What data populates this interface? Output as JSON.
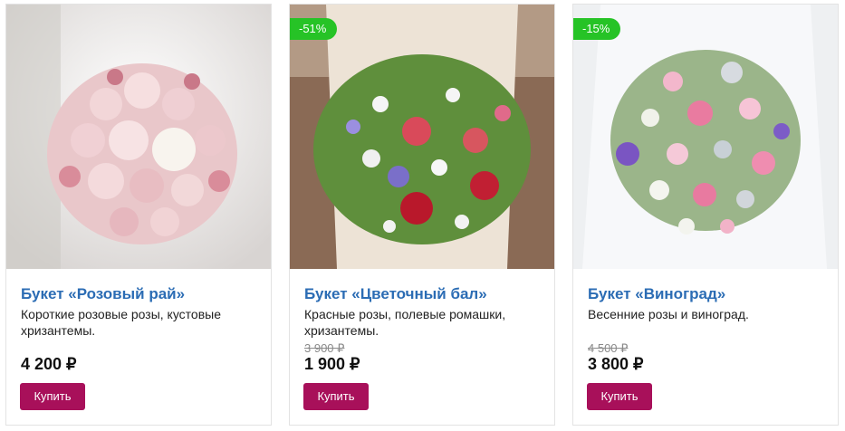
{
  "products": [
    {
      "title": "Букет «Розовый рай»",
      "description": "Короткие розовые розы, кустовые хризантемы.",
      "price": "4 200 ₽",
      "buy_label": "Купить",
      "image_icon": "pink-rose-bouquet-photo"
    },
    {
      "badge": "-51%",
      "title": "Букет «Цветочный бал»",
      "description": "Красные розы, полевые ромашки, хризантемы.",
      "old_price": "3 900 ₽",
      "price": "1 900 ₽",
      "buy_label": "Купить",
      "image_icon": "wildflower-bouquet-photo"
    },
    {
      "badge": "-15%",
      "title": "Букет «Виноград»",
      "description": "Весенние розы и виноград.",
      "old_price": "4 500 ₽",
      "price": "3 800 ₽",
      "buy_label": "Купить",
      "image_icon": "spring-rose-grape-bouquet-photo"
    }
  ],
  "colors": {
    "title": "#2b6cb4",
    "badge": "#26c326",
    "buy_button": "#a8105a",
    "old_price": "#8a8a8a"
  }
}
